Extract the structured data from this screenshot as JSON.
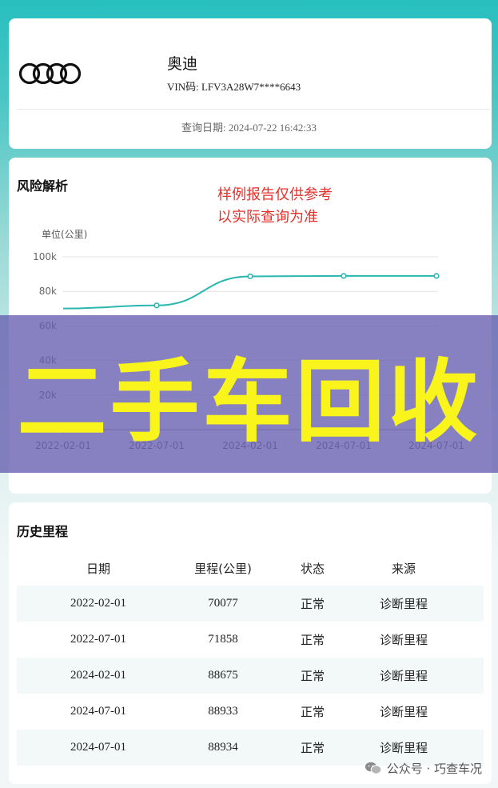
{
  "vehicle": {
    "brand": "奥迪",
    "vin": "VIN码: LFV3A28W7****6643",
    "query_date": "查询日期: 2024-07-22 16:42:33",
    "logo_icon": "audi-rings-icon"
  },
  "risk": {
    "title": "风险解析",
    "sample_note_line1": "样例报告仅供参考",
    "sample_note_line2": "以实际查询为准"
  },
  "overlay": {
    "text": "二手车回收",
    "text_color": "#f8f41c",
    "band_color": "#675daf"
  },
  "chart_data": {
    "type": "line",
    "unit_label": "单位(公里)",
    "x": [
      "2022-02-01",
      "2022-07-01",
      "2024-02-01",
      "2024-07-01",
      "2024-07-01"
    ],
    "x_tick_labels": [
      "2022-02-01",
      "2022-07-01",
      "2024-02-01",
      "2024-07-01",
      "2024-07-01"
    ],
    "y_tick_labels": [
      "0k",
      "20k",
      "40k",
      "60k",
      "80k",
      "100k"
    ],
    "ylim": [
      0,
      100000
    ],
    "series": [
      {
        "values": [
          70077,
          71858,
          88675,
          88933,
          88934
        ],
        "color": "#2bb6b0"
      }
    ],
    "grid": true,
    "legend": "none"
  },
  "history": {
    "title": "历史里程",
    "columns": [
      "日期",
      "里程(公里)",
      "状态",
      "来源"
    ],
    "rows": [
      [
        "2022-02-01",
        "70077",
        "正常",
        "诊断里程"
      ],
      [
        "2022-07-01",
        "71858",
        "正常",
        "诊断里程"
      ],
      [
        "2024-02-01",
        "88675",
        "正常",
        "诊断里程"
      ],
      [
        "2024-07-01",
        "88933",
        "正常",
        "诊断里程"
      ],
      [
        "2024-07-01",
        "88934",
        "正常",
        "诊断里程"
      ]
    ]
  },
  "watermark": {
    "text": "公众号 · 巧查车况",
    "icon": "wechat-icon"
  },
  "colors": {
    "accent": "#27bfbf",
    "note_red": "#e5312b"
  }
}
